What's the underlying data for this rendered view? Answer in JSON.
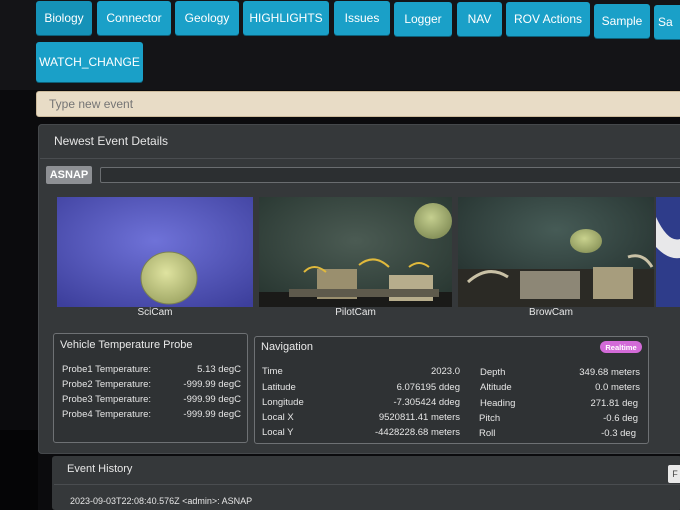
{
  "tabs": [
    {
      "label": "Biology"
    },
    {
      "label": "Connector"
    },
    {
      "label": "Geology"
    },
    {
      "label": "HIGHLIGHTS"
    },
    {
      "label": "Issues"
    },
    {
      "label": "Logger"
    },
    {
      "label": "NAV"
    },
    {
      "label": "ROV Actions"
    },
    {
      "label": "Sample"
    },
    {
      "label": "Sa"
    },
    {
      "label": "WATCH_CHANGE"
    }
  ],
  "event_input": {
    "placeholder": "Type new event"
  },
  "newest_event": {
    "title": "Newest Event Details",
    "event_type": "ASNAP",
    "cameras": [
      {
        "label": "SciCam"
      },
      {
        "label": "PilotCam"
      },
      {
        "label": "BrowCam"
      }
    ]
  },
  "temperature": {
    "title": "Vehicle Temperature Probe",
    "rows": [
      {
        "label": "Probe1 Temperature:",
        "value": "5.13 degC"
      },
      {
        "label": "Probe2 Temperature:",
        "value": "-999.99 degC"
      },
      {
        "label": "Probe3 Temperature:",
        "value": "-999.99 degC"
      },
      {
        "label": "Probe4 Temperature:",
        "value": "-999.99 degC"
      }
    ]
  },
  "navigation": {
    "title": "Navigation",
    "badge": "Realtime",
    "left": [
      {
        "label": "Time",
        "value": "2023.0"
      },
      {
        "label": "Latitude",
        "value": "6.076195 ddeg"
      },
      {
        "label": "Longitude",
        "value": "-7.305424 ddeg"
      },
      {
        "label": "Local X",
        "value": "9520811.41 meters"
      },
      {
        "label": "Local Y",
        "value": "-4428228.68 meters"
      }
    ],
    "right": [
      {
        "label": "Depth",
        "value": "349.68 meters"
      },
      {
        "label": "Altitude",
        "value": "0.0 meters"
      },
      {
        "label": "Heading",
        "value": "271.81 deg"
      },
      {
        "label": "Pitch",
        "value": "-0.6 deg"
      },
      {
        "label": "Roll",
        "value": "-0.3 deg"
      }
    ]
  },
  "event_history": {
    "title": "Event History",
    "button": "F",
    "items": [
      {
        "text": "2023-09-03T22:08:40.576Z <admin>: ASNAP"
      }
    ]
  },
  "colors": {
    "tab": "#1aa0c8",
    "background": "#0b0b0d",
    "panel": "#35383a",
    "badge": "#d36bd8",
    "input": "#e8dcc6"
  }
}
